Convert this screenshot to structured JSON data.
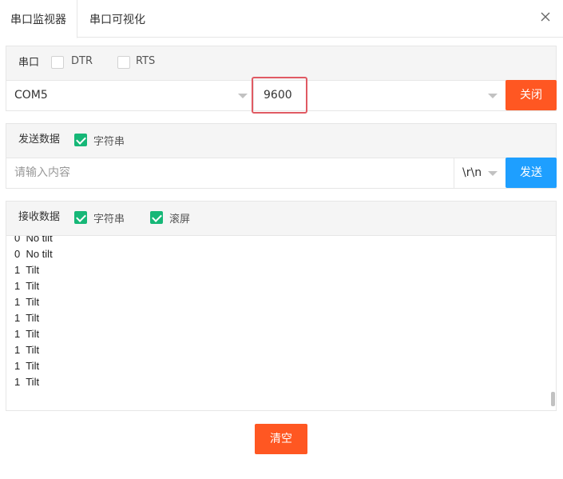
{
  "tabs": [
    {
      "label": "串口监视器"
    },
    {
      "label": "串口可视化"
    }
  ],
  "port_panel": {
    "label": "串口",
    "dtr_label": "DTR",
    "rts_label": "RTS",
    "port_value": "COM5",
    "baud_value": "9600",
    "close_button": "关闭"
  },
  "send_panel": {
    "label": "发送数据",
    "string_label": "字符串",
    "input_placeholder": "请输入内容",
    "line_ending": "\\r\\n",
    "send_button": "发送"
  },
  "recv_panel": {
    "label": "接收数据",
    "string_label": "字符串",
    "scroll_label": "滚屏",
    "lines": [
      "0  No tilt",
      "0  No tilt",
      "1  Tilt",
      "1  Tilt",
      "1  Tilt",
      "1  Tilt",
      "1  Tilt",
      "1  Tilt",
      "1  Tilt",
      "1  Tilt"
    ]
  },
  "clear_button": "清空",
  "colors": {
    "accent_orange": "#ff5722",
    "accent_blue": "#1e9fff",
    "check_green": "#16b777",
    "highlight_red": "#e05a63"
  }
}
